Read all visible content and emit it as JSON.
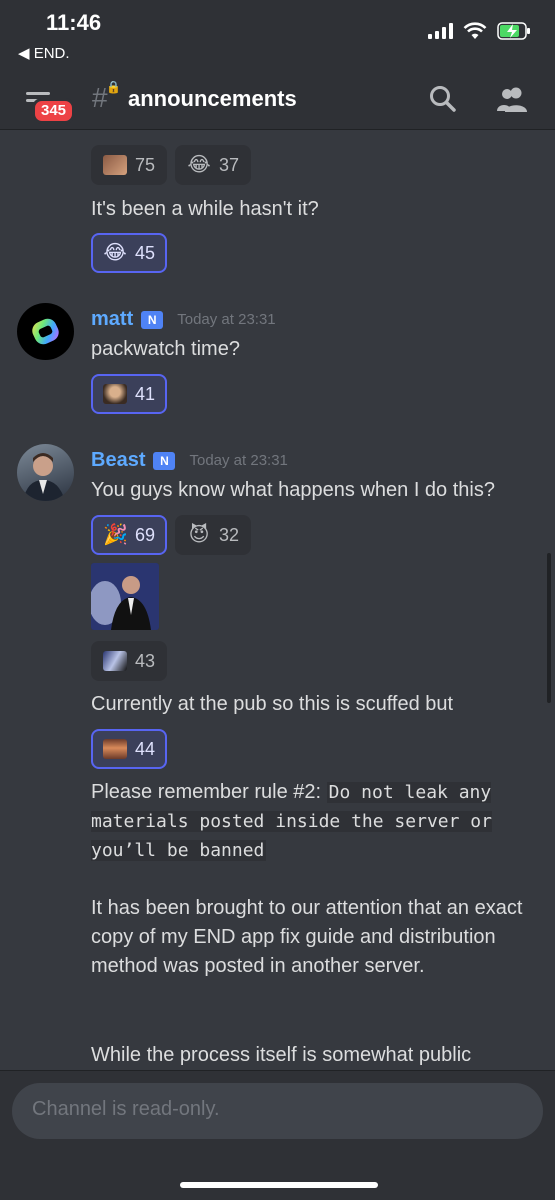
{
  "status_bar": {
    "time": "11:46",
    "back_label": "◀ END."
  },
  "header": {
    "badge": "345",
    "channel": "announcements"
  },
  "messages": [
    {
      "id": "m0",
      "reactions": [
        {
          "count": "75",
          "emoji": "face-emoji"
        },
        {
          "count": "37",
          "emoji": "😂"
        }
      ]
    },
    {
      "id": "m1",
      "text": "It's been a while hasn't it?",
      "reactions": [
        {
          "count": "45",
          "emoji": "😂",
          "mine": true
        }
      ]
    },
    {
      "id": "m2",
      "author": "matt",
      "tag": "N",
      "timestamp": "Today at 23:31",
      "text": "packwatch time?",
      "reactions": [
        {
          "count": "41",
          "emoji": "person-emoji",
          "mine": true
        }
      ]
    },
    {
      "id": "m3",
      "author": "Beast",
      "tag": "N",
      "timestamp": "Today at 23:31",
      "text": "You guys know what happens when I do this?",
      "reactions": [
        {
          "count": "69",
          "emoji": "🎉",
          "mine": true
        },
        {
          "count": "32",
          "emoji": "😈"
        }
      ]
    },
    {
      "id": "m4",
      "reactions": [
        {
          "count": "43",
          "emoji": "smoke-emoji"
        }
      ]
    },
    {
      "id": "m5",
      "text": "Currently at the pub so this is scuffed but",
      "reactions": [
        {
          "count": "44",
          "emoji": "eyes-emoji",
          "mine": true
        }
      ]
    },
    {
      "id": "m6",
      "text_prefix": "Please remember rule #2:",
      "code": "Do not leak any materials posted inside the server or you’ll be banned"
    },
    {
      "id": "m7",
      "text": "It has been brought to our attention that an exact copy of my END app fix guide and distribution method was posted in another server."
    },
    {
      "id": "m8",
      "text": "While the process itself is somewhat public"
    }
  ],
  "input": {
    "placeholder": "Channel is read-only."
  }
}
